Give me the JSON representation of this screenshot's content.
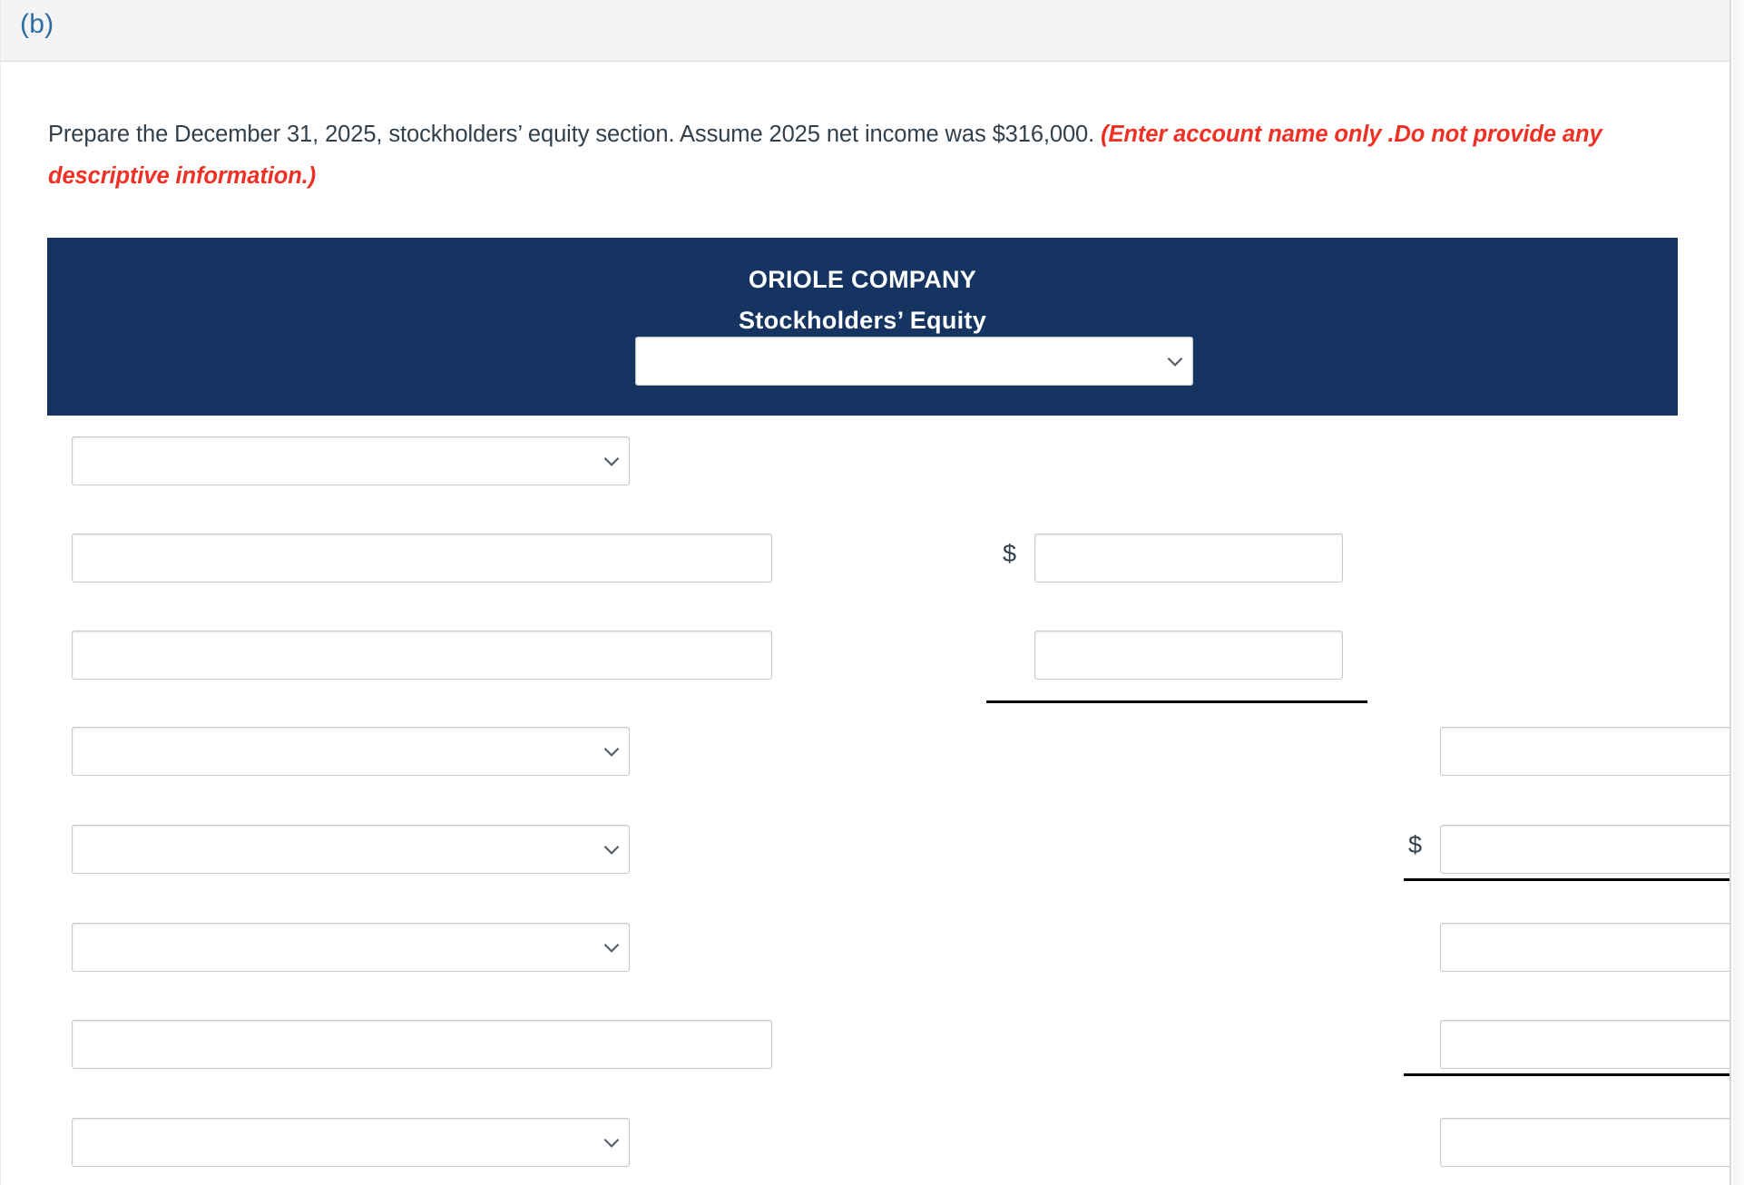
{
  "part": {
    "label": "(b)"
  },
  "instructions": {
    "text_main": "Prepare the December 31, 2025, stockholders’ equity section. Assume 2025 net income was $316,000. ",
    "text_hint": "(Enter account name only .Do not provide any descriptive information.)",
    "net_income": "$316,000",
    "date": "December 31, 2025",
    "hint_color": "#ee3124"
  },
  "statement": {
    "company_name": "ORIOLE COMPANY",
    "title": "Stockholders’ Equity",
    "header_bg": "#153462",
    "period_select": {
      "value": "",
      "icon": "chevron-down-icon"
    }
  },
  "currency_symbols": {
    "mid_column": "$",
    "right_column": "$"
  },
  "rows": [
    {
      "index": 0,
      "left": {
        "type": "select",
        "value": "",
        "icon": "chevron-down-icon"
      },
      "mid": {
        "type": "none"
      },
      "right": {
        "type": "none"
      }
    },
    {
      "index": 1,
      "left": {
        "type": "text",
        "value": ""
      },
      "mid": {
        "type": "text",
        "value": "",
        "dollar": "$"
      },
      "right": {
        "type": "none"
      }
    },
    {
      "index": 2,
      "left": {
        "type": "text",
        "value": ""
      },
      "mid": {
        "type": "text",
        "value": "",
        "rule_below": true
      },
      "right": {
        "type": "none"
      }
    },
    {
      "index": 3,
      "left": {
        "type": "select",
        "value": "",
        "icon": "chevron-down-icon"
      },
      "mid": {
        "type": "none"
      },
      "right": {
        "type": "text",
        "value": ""
      }
    },
    {
      "index": 4,
      "left": {
        "type": "select",
        "value": "",
        "icon": "chevron-down-icon"
      },
      "mid": {
        "type": "none"
      },
      "right": {
        "type": "text",
        "value": "",
        "dollar": "$",
        "rule_below": true
      }
    },
    {
      "index": 5,
      "left": {
        "type": "select",
        "value": "",
        "icon": "chevron-down-icon"
      },
      "mid": {
        "type": "none"
      },
      "right": {
        "type": "text",
        "value": ""
      }
    },
    {
      "index": 6,
      "left": {
        "type": "text",
        "value": ""
      },
      "mid": {
        "type": "none"
      },
      "right": {
        "type": "text",
        "value": "",
        "rule_below": true
      }
    },
    {
      "index": 7,
      "left": {
        "type": "select",
        "value": "",
        "icon": "chevron-down-icon"
      },
      "mid": {
        "type": "none"
      },
      "right": {
        "type": "text",
        "value": ""
      }
    }
  ]
}
